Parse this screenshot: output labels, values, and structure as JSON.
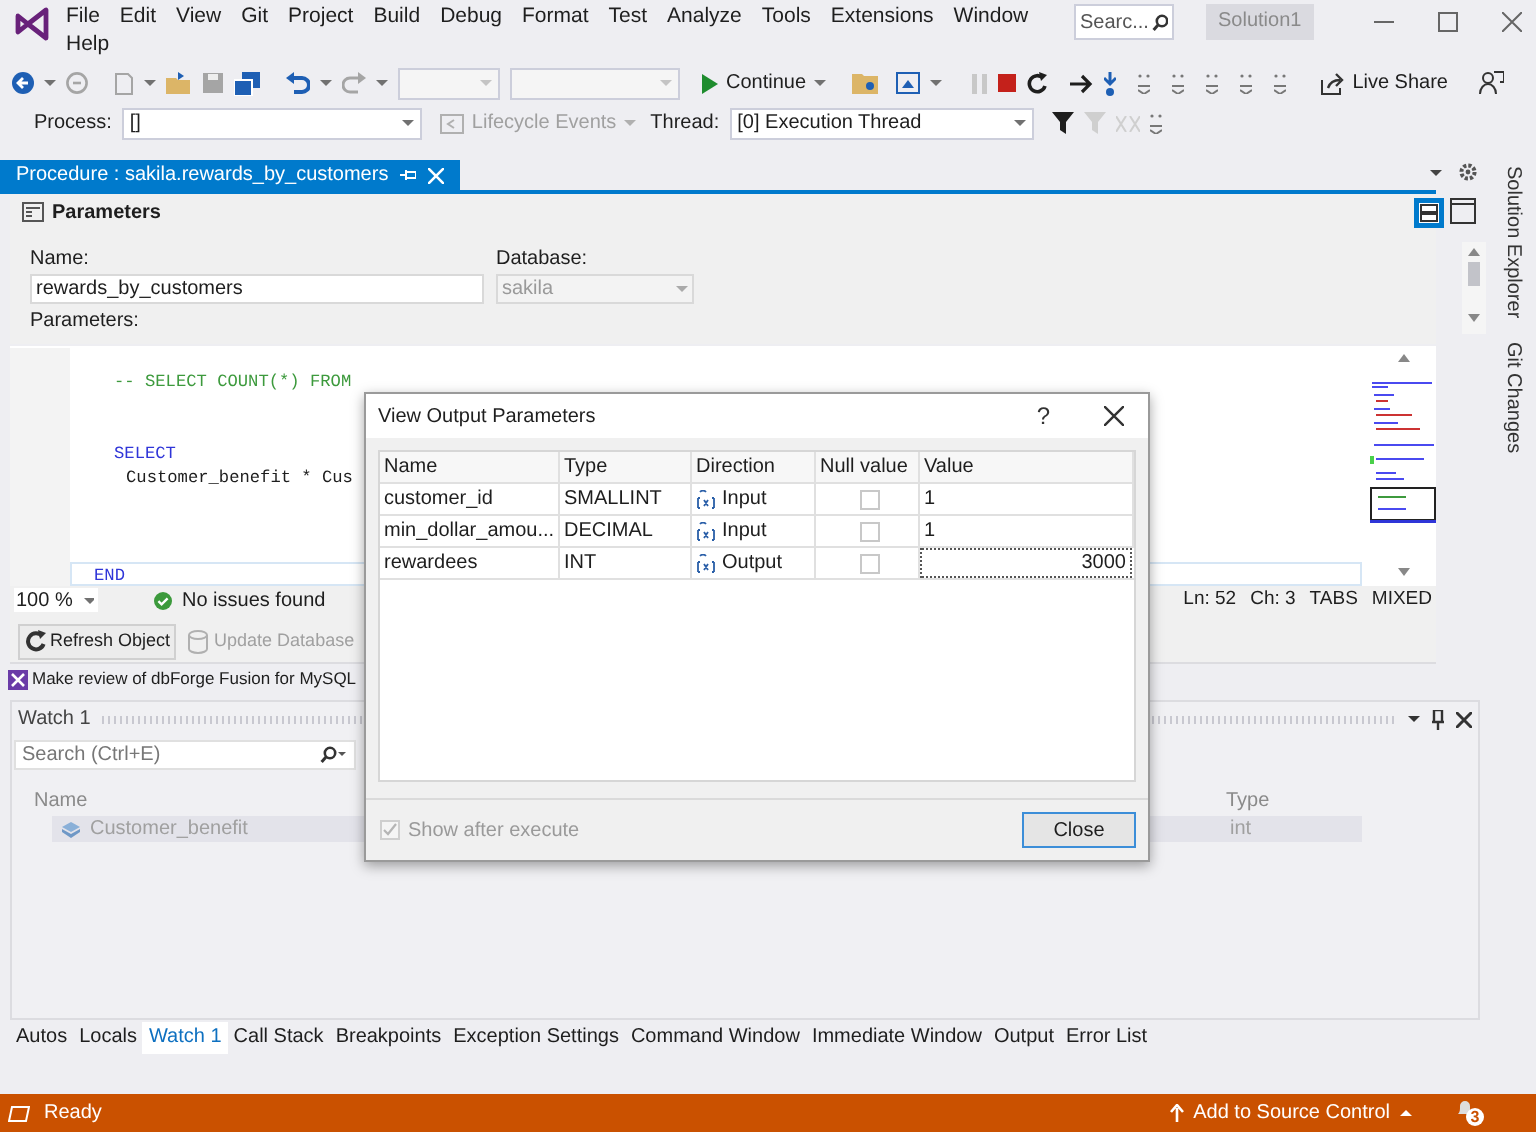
{
  "menu": [
    "File",
    "Edit",
    "View",
    "Git",
    "Project",
    "Build",
    "Debug",
    "Format",
    "Test",
    "Analyze",
    "Tools",
    "Extensions",
    "Window",
    "Help"
  ],
  "search_box": {
    "placeholder": "Searc..."
  },
  "solution_name": "Solution1",
  "toolbar": {
    "continue_label": "Continue",
    "live_share_label": "Live Share"
  },
  "debug_location": {
    "process_label": "Process:",
    "process_value": "[]",
    "lifecycle_events": "Lifecycle Events",
    "thread_label": "Thread:",
    "thread_value": "[0] Execution Thread"
  },
  "document_tab": {
    "title": "Procedure : sakila.rewards_by_customers",
    "selected": true
  },
  "side_tabs": [
    "Solution Explorer",
    "Git Changes"
  ],
  "parameters_panel": {
    "title": "Parameters",
    "name_label": "Name:",
    "name_value": "rewards_by_customers",
    "database_label": "Database:",
    "database_value": "sakila",
    "parameters_label": "Parameters:"
  },
  "editor": {
    "lines": [
      {
        "kind": "comment",
        "text": "-- SELECT COUNT(*) FROM",
        "current": false
      },
      {
        "kind": "keyword",
        "text": "SELECT",
        "current": false
      },
      {
        "kind": "expression",
        "text": "Customer_benefit * Cus",
        "current": false
      },
      {
        "kind": "keyword",
        "text": "END",
        "current": true
      }
    ]
  },
  "editor_status": {
    "zoom": "100 %",
    "issues": "No issues found",
    "line": "Ln: 52",
    "column": "Ch: 3",
    "indent": "TABS",
    "line_endings": "MIXED"
  },
  "object_buttons": [
    {
      "label": "Refresh Object",
      "disabled": false
    },
    {
      "label": "Update Database",
      "disabled": true
    }
  ],
  "notification": "Make review of dbForge Fusion for MySQL",
  "watch": {
    "title": "Watch 1",
    "search_placeholder": "Search (Ctrl+E)",
    "columns": [
      "Name",
      "Type"
    ],
    "rows": [
      {
        "name": "Customer_benefit",
        "type": "int"
      }
    ]
  },
  "bottom_tabs": [
    {
      "label": "Autos",
      "selected": false
    },
    {
      "label": "Locals",
      "selected": false
    },
    {
      "label": "Watch 1",
      "selected": true
    },
    {
      "label": "Call Stack",
      "selected": false
    },
    {
      "label": "Breakpoints",
      "selected": false
    },
    {
      "label": "Exception Settings",
      "selected": false
    },
    {
      "label": "Command Window",
      "selected": false
    },
    {
      "label": "Immediate Window",
      "selected": false
    },
    {
      "label": "Output",
      "selected": false
    },
    {
      "label": "Error List",
      "selected": false
    }
  ],
  "status_bar": {
    "text": "Ready",
    "source_control": "Add to Source Control",
    "notification_count": "3"
  },
  "dialog": {
    "title": "View Output Parameters",
    "help": "?",
    "columns": [
      "Name",
      "Type",
      "Direction",
      "Null value",
      "Value"
    ],
    "rows": [
      {
        "name": "customer_id",
        "type": "SMALLINT",
        "direction": "Input",
        "null_value": false,
        "value": "1",
        "editing": false
      },
      {
        "name": "min_dollar_amou...",
        "type": "DECIMAL",
        "direction": "Input",
        "null_value": false,
        "value": "1",
        "editing": false
      },
      {
        "name": "rewardees",
        "type": "INT",
        "direction": "Output",
        "null_value": false,
        "value": "3000",
        "editing": true
      }
    ],
    "show_after_execute": {
      "label": "Show after execute",
      "checked": true,
      "disabled": true
    },
    "close_button": "Close"
  }
}
